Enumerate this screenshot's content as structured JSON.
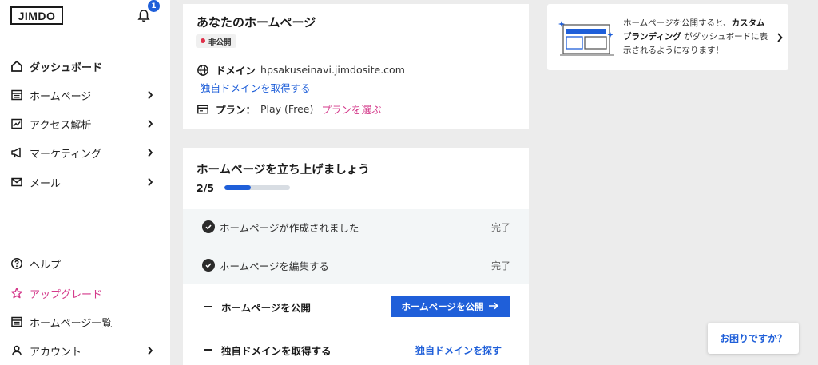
{
  "sidebar": {
    "logo": "JIMDO",
    "notification_count": "1",
    "items": [
      {
        "label": "ダッシュボード",
        "icon": "home-icon"
      },
      {
        "label": "ホームページ",
        "icon": "website-icon"
      },
      {
        "label": "アクセス解析",
        "icon": "analytics-icon"
      },
      {
        "label": "マーケティング",
        "icon": "megaphone-icon"
      },
      {
        "label": "メール",
        "icon": "mail-icon"
      }
    ],
    "bottom_items": [
      {
        "label": "ヘルプ",
        "icon": "help-icon"
      },
      {
        "label": "アップグレード",
        "icon": "star-icon"
      },
      {
        "label": "ホームページ一覧",
        "icon": "website-list-icon"
      },
      {
        "label": "アカウント",
        "icon": "account-icon"
      }
    ]
  },
  "site_card": {
    "title": "あなたのホームページ",
    "status": "非公開",
    "domain_label": "ドメイン",
    "domain_value": "hpsakuseinavi.jimdosite.com",
    "get_domain_link": "独自ドメインを取得する",
    "plan_label": "プラン：",
    "plan_value": "Play (Free)",
    "choose_plan_link": "プランを選ぶ"
  },
  "setup_card": {
    "title": "ホームページを立ち上げましょう",
    "progress_text": "2/5",
    "progress_fraction": 0.4,
    "steps": [
      {
        "label": "ホームページが作成されました",
        "status": "完了"
      },
      {
        "label": "ホームページを編集する",
        "status": "完了"
      },
      {
        "label": "ホームページを公開",
        "action": "ホームページを公開"
      },
      {
        "label": "独自ドメインを取得する",
        "action": "独自ドメインを探す"
      }
    ]
  },
  "promo_card": {
    "text_1": "ホームページを公開すると、",
    "text_bold_1": "カスタムブランディング",
    "text_2": "がダッシュボードに表示されるようになります！"
  },
  "help_button": "お困りですか？",
  "colors": {
    "accent": "#1f5fd9",
    "pink": "#d43a8b",
    "private_dot": "#e0304a"
  }
}
